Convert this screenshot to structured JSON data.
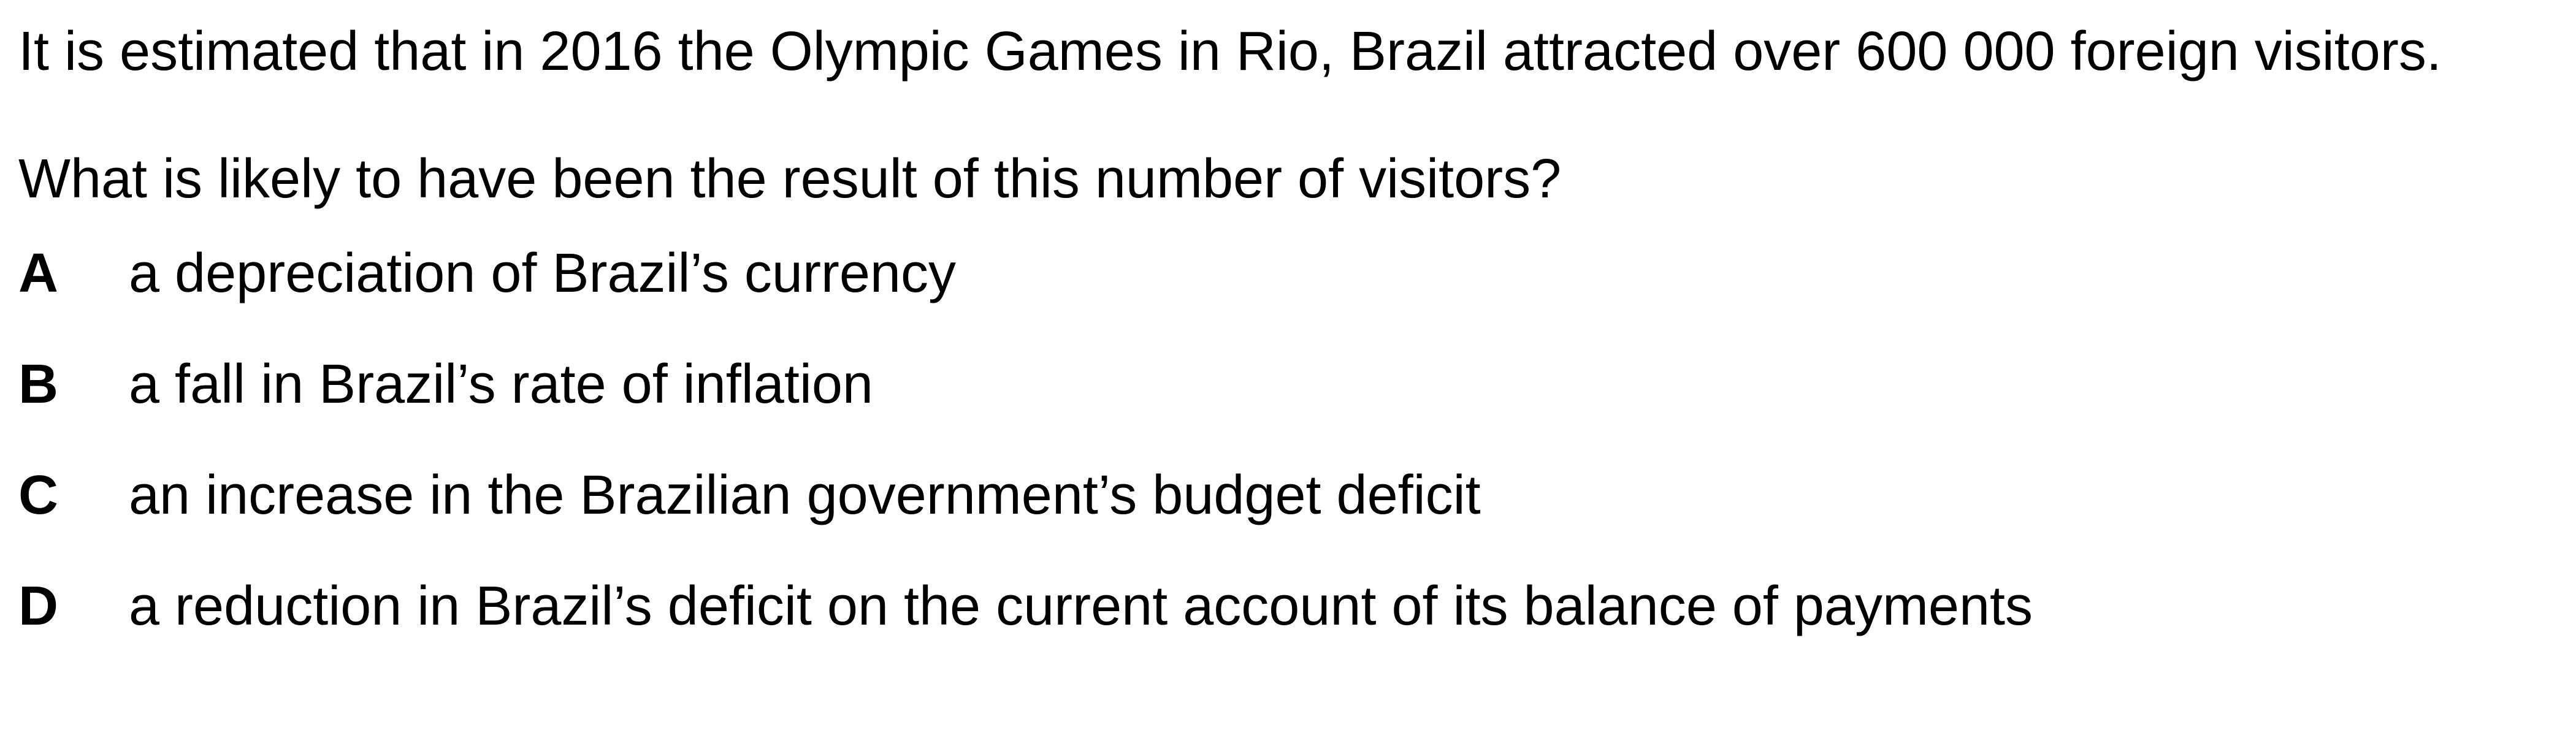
{
  "question": {
    "stem": "It is estimated that in 2016 the Olympic Games in Rio, Brazil attracted over 600 000 foreign visitors.",
    "prompt": "What is likely to have been the result of this number of visitors?",
    "options": [
      {
        "letter": "A",
        "text": "a depreciation of Brazil’s currency"
      },
      {
        "letter": "B",
        "text": "a fall in Brazil’s rate of inflation"
      },
      {
        "letter": "C",
        "text": "an increase in the Brazilian government’s budget deficit"
      },
      {
        "letter": "D",
        "text": "a reduction in Brazil’s deficit on the current account of its balance of payments"
      }
    ]
  }
}
